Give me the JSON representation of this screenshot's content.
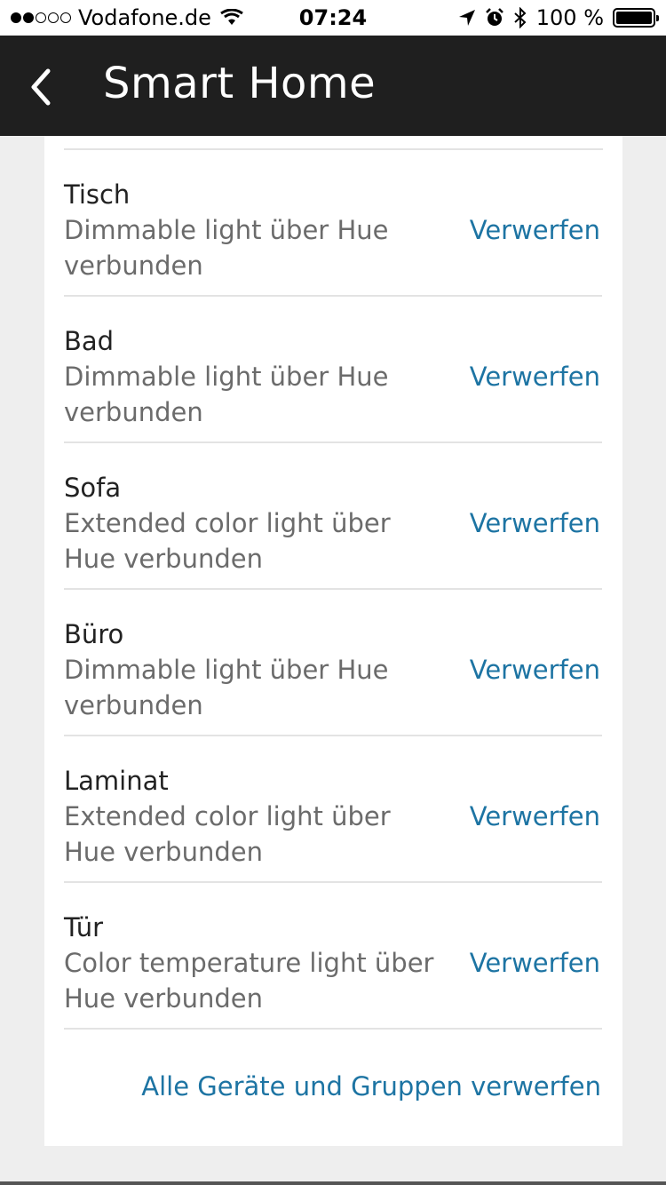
{
  "status_bar": {
    "carrier": "Vodafone.de",
    "time": "07:24",
    "battery": "100 %"
  },
  "header": {
    "title": "Smart Home"
  },
  "devices": [
    {
      "name": "Tisch",
      "desc": "Dimmable light über Hue verbunden",
      "action": "Verwerfen"
    },
    {
      "name": "Bad",
      "desc": "Dimmable light über Hue verbunden",
      "action": "Verwerfen"
    },
    {
      "name": "Sofa",
      "desc": "Extended color light über Hue verbunden",
      "action": "Verwerfen"
    },
    {
      "name": "Büro",
      "desc": "Dimmable light über Hue verbunden",
      "action": "Verwerfen"
    },
    {
      "name": "Laminat",
      "desc": "Extended color light über Hue verbunden",
      "action": "Verwerfen"
    },
    {
      "name": "Tür",
      "desc": "Color temperature light über Hue verbunden",
      "action": "Verwerfen"
    }
  ],
  "footer": {
    "discard_all": "Alle Geräte und Gruppen verwerfen"
  },
  "colors": {
    "accent": "#1d74a3",
    "navbar": "#1f1f1f"
  }
}
